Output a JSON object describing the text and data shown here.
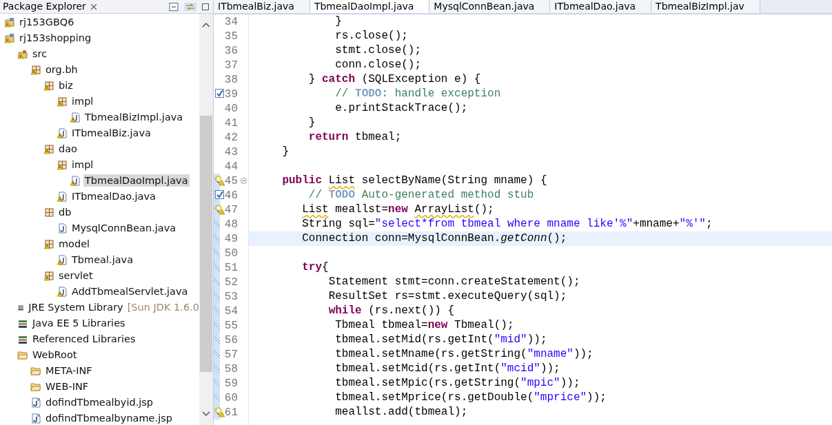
{
  "explorer": {
    "title": "Package Explorer",
    "tree": [
      {
        "label": "rj153GBQ6",
        "kind": "project",
        "warning": true,
        "selected": false
      },
      {
        "label": "rj153shopping",
        "kind": "project",
        "warning": true,
        "selected": false,
        "children": [
          {
            "label": "src",
            "kind": "source",
            "warning": true,
            "selected": false,
            "children": [
              {
                "label": "org.bh",
                "kind": "package",
                "warning": true,
                "selected": false,
                "children": [
                  {
                    "label": "biz",
                    "kind": "package",
                    "warning": true,
                    "selected": false,
                    "children": [
                      {
                        "label": "impl",
                        "kind": "package",
                        "warning": true,
                        "selected": false,
                        "children": [
                          {
                            "label": "TbmealBizImpl.java",
                            "kind": "java",
                            "warning": true,
                            "selected": false
                          }
                        ]
                      },
                      {
                        "label": "ITbmealBiz.java",
                        "kind": "java",
                        "warning": true,
                        "selected": false
                      }
                    ]
                  },
                  {
                    "label": "dao",
                    "kind": "package",
                    "warning": true,
                    "selected": false,
                    "children": [
                      {
                        "label": "impl",
                        "kind": "package",
                        "warning": true,
                        "selected": false,
                        "children": [
                          {
                            "label": "TbmealDaoImpl.java",
                            "kind": "java",
                            "warning": true,
                            "selected": true
                          }
                        ]
                      },
                      {
                        "label": "ITbmealDao.java",
                        "kind": "java",
                        "warning": true,
                        "selected": false
                      }
                    ]
                  },
                  {
                    "label": "db",
                    "kind": "package",
                    "warning": false,
                    "selected": false,
                    "children": [
                      {
                        "label": "MysqlConnBean.java",
                        "kind": "java",
                        "warning": false,
                        "selected": false
                      }
                    ]
                  },
                  {
                    "label": "model",
                    "kind": "package",
                    "warning": true,
                    "selected": false,
                    "children": [
                      {
                        "label": "Tbmeal.java",
                        "kind": "java",
                        "warning": true,
                        "selected": false
                      }
                    ]
                  },
                  {
                    "label": "servlet",
                    "kind": "package",
                    "warning": true,
                    "selected": false,
                    "children": [
                      {
                        "label": "AddTbmealServlet.java",
                        "kind": "java",
                        "warning": true,
                        "selected": false
                      }
                    ]
                  }
                ]
              }
            ]
          },
          {
            "label": "JRE System Library",
            "suffix": "[Sun JDK 1.6.0",
            "kind": "library",
            "warning": false,
            "selected": false
          },
          {
            "label": "Java EE 5 Libraries",
            "kind": "library",
            "warning": false,
            "selected": false
          },
          {
            "label": "Referenced Libraries",
            "kind": "library",
            "warning": false,
            "selected": false
          },
          {
            "label": "WebRoot",
            "kind": "folder",
            "warning": false,
            "selected": false,
            "children": [
              {
                "label": "META-INF",
                "kind": "folder",
                "warning": false,
                "selected": false
              },
              {
                "label": "WEB-INF",
                "kind": "folder",
                "warning": false,
                "selected": false
              },
              {
                "label": "dofindTbmealbyid.jsp",
                "kind": "jsp",
                "warning": false,
                "selected": false
              },
              {
                "label": "dofindTbmealbyname.jsp",
                "kind": "jsp",
                "warning": false,
                "selected": false
              }
            ]
          }
        ]
      }
    ]
  },
  "editor": {
    "tabs": [
      {
        "label": "ITbmealBiz.java",
        "selected": false
      },
      {
        "label": "TbmealDaoImpl.java",
        "selected": true
      },
      {
        "label": "MysqlConnBean.java",
        "selected": false
      },
      {
        "label": "ITbmealDao.java",
        "selected": false
      },
      {
        "label": "TbmealBizImpl.jav",
        "selected": false
      }
    ],
    "lines": [
      {
        "number": "34",
        "current": false,
        "in_range": false,
        "tokens": [
          {
            "kind": "plain",
            "text": "            }"
          }
        ]
      },
      {
        "number": "35",
        "current": false,
        "in_range": false,
        "tokens": [
          {
            "kind": "plain",
            "text": "            rs.close();"
          }
        ]
      },
      {
        "number": "36",
        "current": false,
        "in_range": false,
        "tokens": [
          {
            "kind": "plain",
            "text": "            stmt.close();"
          }
        ]
      },
      {
        "number": "37",
        "current": false,
        "in_range": false,
        "tokens": [
          {
            "kind": "plain",
            "text": "            conn.close();"
          }
        ]
      },
      {
        "number": "38",
        "current": false,
        "in_range": false,
        "tokens": [
          {
            "kind": "plain",
            "text": "        } "
          },
          {
            "kind": "keyword",
            "text": "catch"
          },
          {
            "kind": "plain",
            "text": " (SQLException e) {"
          }
        ]
      },
      {
        "number": "39",
        "kind": "task",
        "current": false,
        "in_range": false,
        "tokens": [
          {
            "kind": "comment",
            "text": "            // "
          },
          {
            "kind": "todo",
            "text": "TODO"
          },
          {
            "kind": "comment",
            "text": ": handle exception"
          }
        ]
      },
      {
        "number": "40",
        "current": false,
        "in_range": false,
        "tokens": [
          {
            "kind": "plain",
            "text": "            e.printStackTrace();"
          }
        ]
      },
      {
        "number": "41",
        "current": false,
        "in_range": false,
        "tokens": [
          {
            "kind": "plain",
            "text": "        }"
          }
        ]
      },
      {
        "number": "42",
        "current": false,
        "in_range": false,
        "tokens": [
          {
            "kind": "keyword",
            "text": "        return"
          },
          {
            "kind": "plain",
            "text": " tbmeal;"
          }
        ]
      },
      {
        "number": "43",
        "current": false,
        "in_range": false,
        "tokens": [
          {
            "kind": "plain",
            "text": "    }"
          }
        ]
      },
      {
        "number": "44",
        "current": false,
        "in_range": false
      },
      {
        "number": "45",
        "kind": "warning",
        "fold": true,
        "current": false,
        "in_range": true,
        "tokens": [
          {
            "kind": "keyword",
            "text": "    public "
          },
          {
            "kind": "warn",
            "text": "List"
          },
          {
            "kind": "plain",
            "text": " selectByName(String mname) {"
          }
        ]
      },
      {
        "number": "46",
        "kind": "task",
        "current": false,
        "in_range": true,
        "tokens": [
          {
            "kind": "comment",
            "text": "        // "
          },
          {
            "kind": "todo",
            "text": "TODO"
          },
          {
            "kind": "comment",
            "text": " Auto-generated method stub"
          }
        ]
      },
      {
        "number": "47",
        "kind": "warning",
        "current": false,
        "in_range": true,
        "tokens": [
          {
            "kind": "warn",
            "text": "       List"
          },
          {
            "kind": "plain",
            "text": " meallst="
          },
          {
            "kind": "keyword",
            "text": "new "
          },
          {
            "kind": "warn",
            "text": "ArrayList"
          },
          {
            "kind": "plain",
            "text": "();"
          }
        ]
      },
      {
        "number": "48",
        "current": false,
        "in_range": true,
        "tokens": [
          {
            "kind": "plain",
            "text": "       String sql="
          },
          {
            "kind": "string",
            "text": "\"select*from tbmeal where mname like'%\""
          },
          {
            "kind": "plain",
            "text": "+mname+"
          },
          {
            "kind": "string",
            "text": "\"%'\""
          },
          {
            "kind": "plain",
            "text": ";"
          }
        ]
      },
      {
        "number": "49",
        "current": true,
        "in_range": true,
        "tokens": [
          {
            "kind": "plain",
            "text": "       Connection conn=MysqlConnBean."
          },
          {
            "kind": "italic",
            "text": "getConn"
          },
          {
            "kind": "plain",
            "text": "();"
          }
        ]
      },
      {
        "number": "50",
        "current": false,
        "in_range": true
      },
      {
        "number": "51",
        "current": false,
        "in_range": true,
        "tokens": [
          {
            "kind": "keyword",
            "text": "       try"
          },
          {
            "kind": "plain",
            "text": "{"
          }
        ]
      },
      {
        "number": "52",
        "current": false,
        "in_range": true,
        "tokens": [
          {
            "kind": "plain",
            "text": "           Statement stmt=conn.createStatement();"
          }
        ]
      },
      {
        "number": "53",
        "current": false,
        "in_range": true,
        "tokens": [
          {
            "kind": "plain",
            "text": "           ResultSet rs=stmt.executeQuery(sql);"
          }
        ]
      },
      {
        "number": "54",
        "current": false,
        "in_range": true,
        "tokens": [
          {
            "kind": "keyword",
            "text": "           while"
          },
          {
            "kind": "plain",
            "text": " (rs.next()) {"
          }
        ]
      },
      {
        "number": "55",
        "current": false,
        "in_range": true,
        "tokens": [
          {
            "kind": "plain",
            "text": "            Tbmeal tbmeal="
          },
          {
            "kind": "keyword",
            "text": "new"
          },
          {
            "kind": "plain",
            "text": " Tbmeal();"
          }
        ]
      },
      {
        "number": "56",
        "current": false,
        "in_range": true,
        "tokens": [
          {
            "kind": "plain",
            "text": "            tbmeal.setMid(rs.getInt("
          },
          {
            "kind": "string",
            "text": "\"mid\""
          },
          {
            "kind": "plain",
            "text": "));"
          }
        ]
      },
      {
        "number": "57",
        "current": false,
        "in_range": true,
        "tokens": [
          {
            "kind": "plain",
            "text": "            tbmeal.setMname(rs.getString("
          },
          {
            "kind": "string",
            "text": "\"mname\""
          },
          {
            "kind": "plain",
            "text": "));"
          }
        ]
      },
      {
        "number": "58",
        "current": false,
        "in_range": true,
        "tokens": [
          {
            "kind": "plain",
            "text": "            tbmeal.setMcid(rs.getInt("
          },
          {
            "kind": "string",
            "text": "\"mcid\""
          },
          {
            "kind": "plain",
            "text": "));"
          }
        ]
      },
      {
        "number": "59",
        "current": false,
        "in_range": true,
        "tokens": [
          {
            "kind": "plain",
            "text": "            tbmeal.setMpic(rs.getString("
          },
          {
            "kind": "string",
            "text": "\"mpic\""
          },
          {
            "kind": "plain",
            "text": "));"
          }
        ]
      },
      {
        "number": "60",
        "current": false,
        "in_range": true,
        "tokens": [
          {
            "kind": "plain",
            "text": "            tbmeal.setMprice(rs.getDouble("
          },
          {
            "kind": "string",
            "text": "\"mprice\""
          },
          {
            "kind": "plain",
            "text": "));"
          }
        ]
      },
      {
        "number": "61",
        "kind": "warning",
        "current": false,
        "in_range": true,
        "tokens": [
          {
            "kind": "plain",
            "text": "            meallst.add(tbmeal);"
          }
        ]
      }
    ]
  }
}
